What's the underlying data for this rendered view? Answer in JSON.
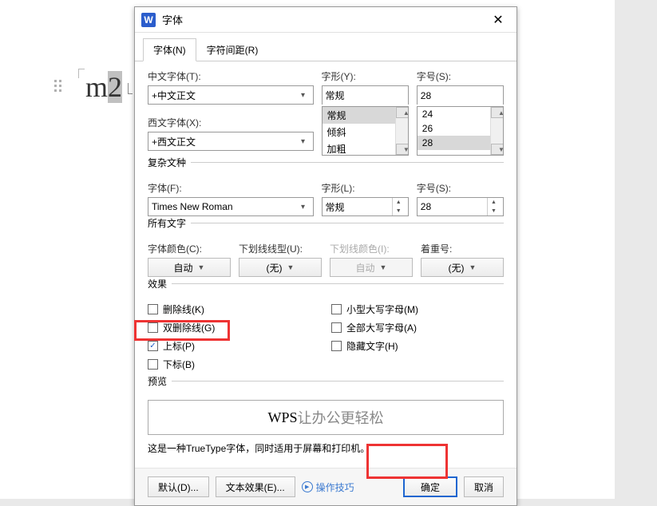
{
  "doc": {
    "before": "m",
    "selected": "2"
  },
  "title": "字体",
  "title_icon": "W",
  "tabs": {
    "font": "字体(N)",
    "spacing": "字符间距(R)"
  },
  "labels": {
    "cfont": "中文字体(T):",
    "wfont": "西文字体(X):",
    "style": "字形(Y):",
    "size": "字号(S):",
    "section_complex": "复杂文种",
    "cplx_font": "字体(F):",
    "cplx_style": "字形(L):",
    "cplx_size": "字号(S):",
    "section_all": "所有文字",
    "fontcolor": "字体颜色(C):",
    "underline": "下划线线型(U):",
    "underline_color": "下划线颜色(I):",
    "emphasis": "着重号:",
    "section_effects": "效果",
    "preview": "预览",
    "hint": "这是一种TrueType字体，同时适用于屏幕和打印机。"
  },
  "values": {
    "cfont": "+中文正文",
    "wfont": "+西文正文",
    "style_selected": "常规",
    "style_list": [
      "常规",
      "倾斜",
      "加粗"
    ],
    "size_value": "28",
    "size_list": [
      "24",
      "26",
      "28"
    ],
    "cplx_font": "Times New Roman",
    "cplx_style": "常规",
    "cplx_size": "28",
    "fontcolor": "自动",
    "underline": "(无)",
    "underline_color": "自动",
    "emphasis": "(无)"
  },
  "effects": {
    "strike": "删除线(K)",
    "dblstrike": "双删除线(G)",
    "superscript": "上标(P)",
    "subscript": "下标(B)",
    "smallcaps": "小型大写字母(M)",
    "allcaps": "全部大写字母(A)",
    "hidden": "隐藏文字(H)"
  },
  "preview_text": {
    "brand": "WPS ",
    "slogan": "让办公更轻松"
  },
  "buttons": {
    "default": "默认(D)...",
    "texteffect": "文本效果(E)...",
    "tips": "操作技巧",
    "ok": "确定",
    "cancel": "取消"
  }
}
